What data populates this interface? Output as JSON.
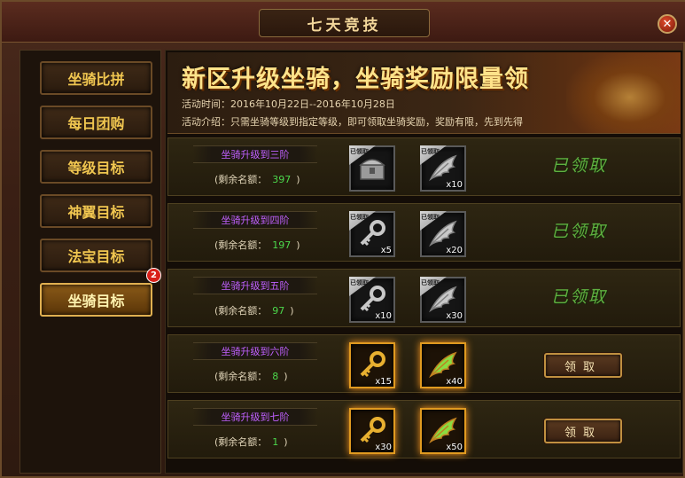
{
  "window": {
    "title": "七天竞技",
    "close_label": "✕"
  },
  "sidebar": {
    "items": [
      {
        "label": "坐骑比拼"
      },
      {
        "label": "每日团购"
      },
      {
        "label": "等级目标"
      },
      {
        "label": "神翼目标"
      },
      {
        "label": "法宝目标"
      },
      {
        "label": "坐骑目标"
      }
    ],
    "active_index": 5,
    "badge_count": "2"
  },
  "banner": {
    "title": "新区升级坐骑，坐骑奖励限量领",
    "time": "活动时间：2016年10月22日--2016年10月28日",
    "intro": "活动介绍：只需坐骑等级到指定等级，即可领取坐骑奖励，奖励有限，先到先得"
  },
  "rows": [
    {
      "tier": "坐骑升级到三阶",
      "remain_label": "(剩余名额：",
      "remain": "397",
      "remain_close": ")",
      "items": [
        {
          "icon": "treasure-chest-icon",
          "count": "",
          "claimed": true,
          "tag": "已领取"
        },
        {
          "icon": "feather-wing-icon",
          "count": "x10",
          "claimed": true,
          "tag": "已领取"
        }
      ],
      "status": "claimed",
      "status_label": "已领取"
    },
    {
      "tier": "坐骑升级到四阶",
      "remain_label": "(剩余名额：",
      "remain": "197",
      "remain_close": ")",
      "items": [
        {
          "icon": "key-icon",
          "count": "x5",
          "claimed": true,
          "tag": "已领取"
        },
        {
          "icon": "feather-wing-icon",
          "count": "x20",
          "claimed": true,
          "tag": "已领取"
        }
      ],
      "status": "claimed",
      "status_label": "已领取"
    },
    {
      "tier": "坐骑升级到五阶",
      "remain_label": "(剩余名额：",
      "remain": "97",
      "remain_close": ")",
      "items": [
        {
          "icon": "key-icon",
          "count": "x10",
          "claimed": true,
          "tag": "已领取"
        },
        {
          "icon": "feather-wing-icon",
          "count": "x30",
          "claimed": true,
          "tag": "已领取"
        }
      ],
      "status": "claimed",
      "status_label": "已领取"
    },
    {
      "tier": "坐骑升级到六阶",
      "remain_label": "(剩余名额：",
      "remain": "8",
      "remain_close": ")",
      "items": [
        {
          "icon": "key-icon",
          "count": "x15",
          "claimed": false
        },
        {
          "icon": "feather-wing-icon",
          "count": "x40",
          "claimed": false
        }
      ],
      "status": "available",
      "button_label": "领取"
    },
    {
      "tier": "坐骑升级到七阶",
      "remain_label": "(剩余名额：",
      "remain": "1",
      "remain_close": ")",
      "items": [
        {
          "icon": "key-icon",
          "count": "x30",
          "claimed": false
        },
        {
          "icon": "feather-wing-icon",
          "count": "x50",
          "claimed": false
        }
      ],
      "status": "available",
      "button_label": "领取"
    }
  ]
}
